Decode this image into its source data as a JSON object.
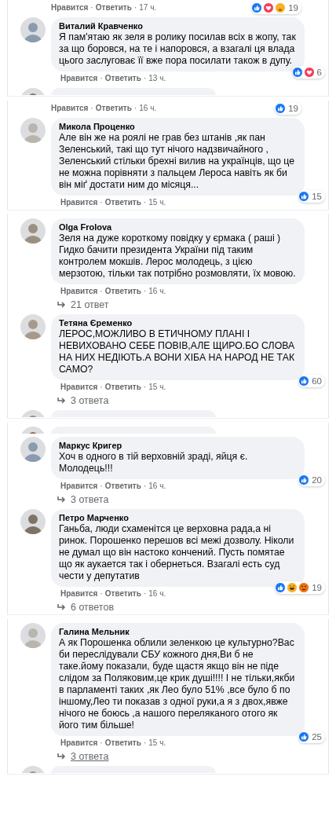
{
  "panels": [
    {
      "items": [
        {
          "kind": "meta",
          "meta": {
            "like": "Нравится",
            "sep1": "·",
            "reply": "Ответить",
            "sep2": "·",
            "time": "17 ч."
          },
          "reactions": [
            {
              "kind": "like"
            },
            {
              "kind": "love"
            },
            {
              "kind": "care"
            }
          ],
          "count": "19"
        },
        {
          "kind": "comment",
          "author": "Виталий Кравченко",
          "text": "Я пам'ятаю як зеля в ролику посилав всіх в жопу, так за що боровся, на те і напоровся, а взагалі ця влада цього заслуговає її вже пора посилати також в дупу.",
          "reactions": [
            {
              "kind": "like"
            },
            {
              "kind": "love"
            }
          ],
          "count": "6",
          "meta": {
            "like": "Нравится",
            "sep1": "·",
            "reply": "Ответить",
            "sep2": "·",
            "time": "13 ч."
          }
        },
        {
          "kind": "stub"
        }
      ]
    },
    {
      "items": [
        {
          "kind": "meta",
          "meta": {
            "like": "Нравится",
            "sep1": "·",
            "reply": "Ответить",
            "sep2": "·",
            "time": "16 ч."
          },
          "reactions": [
            {
              "kind": "like"
            }
          ],
          "count": "19"
        },
        {
          "kind": "comment",
          "author": "Микола Проценко",
          "text": "Але він же на роялі не грав без штанів ,як пан Зеленський, такі що тут нічого надзвичайного , Зеленський стільки брехні вилив на українців, що це не можна порівняти з пальцем Лероса навіть як би він міґ достати ним до місяця...",
          "reactions": [
            {
              "kind": "like"
            }
          ],
          "count": "15",
          "meta": {
            "like": "Нравится",
            "sep1": "·",
            "reply": "Ответить",
            "sep2": "·",
            "time": "15 ч."
          }
        }
      ]
    },
    {
      "items": [
        {
          "kind": "comment",
          "author": "Olga Frolova",
          "text": "Зеля на дуже короткому повідку у єрмака ( раші ) Гидко бачити президента України під таким контролем мокшів. Лерос молодець, з цією мерзотою, тільки так потрібно розмовляти, їх мовою.",
          "meta": {
            "like": "Нравится",
            "sep1": "·",
            "reply": "Ответить",
            "sep2": "·",
            "time": "16 ч."
          },
          "replies": {
            "label": "21 ответ",
            "hovered": false
          }
        },
        {
          "kind": "comment",
          "author": "Тетяна Єременко",
          "text": "ЛЕРОС,МОЖЛИВО В ЕТИЧНОМУ ПЛАНІ І НЕВИХОВАНО СЕБЕ ПОВІВ,АЛЕ ЩИРО.БО СЛОВА НА НИХ НЕДІЮТЬ.А ВОНИ ХІБА НА НАРОД НЕ ТАК САМО?",
          "reactions": [
            {
              "kind": "like"
            }
          ],
          "count": "60",
          "meta": {
            "like": "Нравится",
            "sep1": "·",
            "reply": "Ответить",
            "sep2": "·",
            "time": "15 ч."
          },
          "replies": {
            "label": "3 ответа",
            "hovered": false
          }
        },
        {
          "kind": "stub"
        }
      ]
    },
    {
      "items": [
        {
          "kind": "stub"
        },
        {
          "kind": "comment",
          "author": "Маркус Кригер",
          "text": "Хоч в одного в тій верховній зраді, яйця є. Молодець!!!",
          "reactions": [
            {
              "kind": "like"
            }
          ],
          "count": "20",
          "meta": {
            "like": "Нравится",
            "sep1": "·",
            "reply": "Ответить",
            "sep2": "·",
            "time": "16 ч."
          },
          "replies": {
            "label": "3 ответа",
            "hovered": false
          }
        },
        {
          "kind": "comment",
          "author": "Петро Марченко",
          "text": "Ганьба, люди схаменітся це верховна рада,а ні ринок. Порошенко перешов всі межі дозволу. Ніколи не думал що він настоко кончений. Пусть помятае що як аукается так і обернеться. Взагалі есть суд чести у депутатив",
          "reactions": [
            {
              "kind": "like"
            },
            {
              "kind": "haha"
            },
            {
              "kind": "angry"
            }
          ],
          "count": "19",
          "meta": {
            "like": "Нравится",
            "sep1": "·",
            "reply": "Ответить",
            "sep2": "·",
            "time": "16 ч."
          },
          "replies": {
            "label": "6 ответов",
            "hovered": false
          }
        }
      ]
    },
    {
      "items": [
        {
          "kind": "comment",
          "author": "Галина Мельник",
          "text": "А як Порошенка облили зеленкою це культурно?Вас би переслідували СБУ кожного дня,Ви б не таке.йому показали, буде щастя якщо він не піде слідом за Поляковим,це крик душі!!!! І не тільки,якби в парламенті таких ,як Лео було 51% ,все було б по іншому,Лео ти показав з одної руки,а я з двох,явже нічого не боюсь ,а нашого переляканого отого як його тим більше!",
          "reactions": [
            {
              "kind": "like"
            }
          ],
          "count": "25",
          "meta": {
            "like": "Нравится",
            "sep1": "·",
            "reply": "Ответить",
            "sep2": "·",
            "time": "15 ч."
          },
          "replies": {
            "label": "3 ответа",
            "hovered": true
          }
        },
        {
          "kind": "stub"
        }
      ]
    }
  ]
}
